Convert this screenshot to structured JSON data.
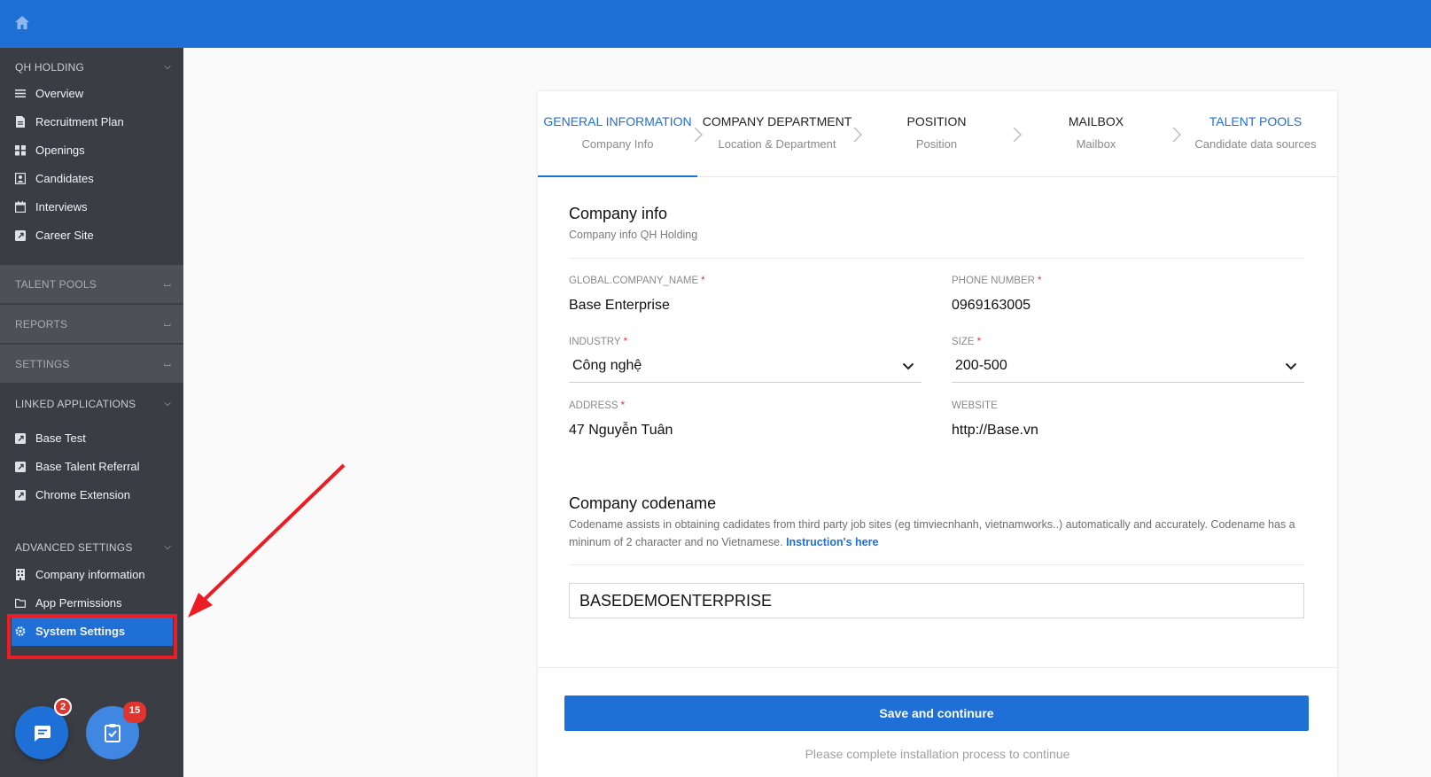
{
  "topbar": {
    "home_icon": "home-icon",
    "color": "#1e6fd6"
  },
  "sidebar": {
    "company": "QH HOLDING",
    "main_items": [
      {
        "label": "Overview",
        "icon": "list-icon"
      },
      {
        "label": "Recruitment Plan",
        "icon": "document-icon"
      },
      {
        "label": "Openings",
        "icon": "grid-icon"
      },
      {
        "label": "Candidates",
        "icon": "candidate-icon"
      },
      {
        "label": "Interviews",
        "icon": "calendar-icon"
      },
      {
        "label": "Career Site",
        "icon": "external-link-icon"
      }
    ],
    "talent_pools": "TALENT POOLS",
    "reports": "REPORTS",
    "settings": "SETTINGS",
    "linked_applications": "LINKED APPLICATIONS",
    "linked_items": [
      {
        "label": "Base Test",
        "icon": "external-link-icon"
      },
      {
        "label": "Base Talent Referral",
        "icon": "external-link-icon"
      },
      {
        "label": "Chrome Extension",
        "icon": "external-link-icon"
      }
    ],
    "advanced_settings": "ADVANCED SETTINGS",
    "advanced_items": [
      {
        "label": "Company information",
        "icon": "building-icon"
      },
      {
        "label": "App Permissions",
        "icon": "folder-icon"
      },
      {
        "label": "System Settings",
        "icon": "gear-icon",
        "active": true
      }
    ],
    "chat_badge": "2",
    "task_badge": "15"
  },
  "steps": [
    {
      "title": "GENERAL INFORMATION",
      "subtitle": "Company Info"
    },
    {
      "title": "COMPANY DEPARTMENT",
      "subtitle": "Location & Department"
    },
    {
      "title": "POSITION",
      "subtitle": "Position"
    },
    {
      "title": "MAILBOX",
      "subtitle": "Mailbox"
    },
    {
      "title": "TALENT POOLS",
      "subtitle": "Candidate data sources"
    }
  ],
  "company_info": {
    "title": "Company info",
    "subtitle": "Company info QH Holding",
    "fields": {
      "company_name_label": "GLOBAL.COMPANY_NAME",
      "company_name_value": "Base Enterprise",
      "phone_label": "PHONE NUMBER",
      "phone_value": "0969163005",
      "industry_label": "INDUSTRY",
      "industry_value": "Công nghệ",
      "size_label": "SIZE",
      "size_value": "200-500",
      "address_label": "ADDRESS",
      "address_value": "47 Nguyễn Tuân",
      "website_label": "WEBSITE",
      "website_value": "http://Base.vn"
    }
  },
  "codename": {
    "title": "Company codename",
    "description": "Codename assists in obtaining cadidates from third party job sites (eg timviecnhanh, vietnamworks..) automatically and accurately. Codename has a mininum of 2 character and no Vietnamese.",
    "link": "Instruction's here",
    "value": "BASEDEMOENTERPRISE"
  },
  "footer": {
    "save_label": "Save and continure",
    "note": "Please complete installation process to continue"
  },
  "colors": {
    "accent": "#1e6fd6",
    "sidebar": "#3a3e44",
    "annotation": "#ec1c24"
  }
}
